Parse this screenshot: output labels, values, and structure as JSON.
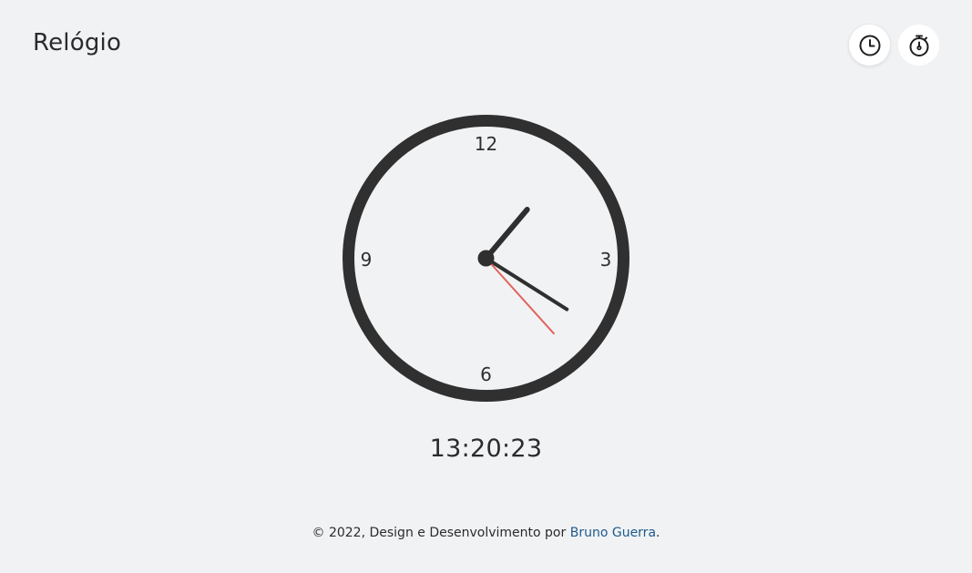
{
  "header": {
    "title": "Relógio"
  },
  "mode_switcher": {
    "items": [
      {
        "icon": "clock-icon",
        "active": true
      },
      {
        "icon": "stopwatch-icon",
        "active": false
      }
    ]
  },
  "clock": {
    "numerals": {
      "twelve": "12",
      "three": "3",
      "six": "6",
      "nine": "9"
    },
    "time": {
      "hours": 13,
      "minutes": 20,
      "seconds": 23
    },
    "colors": {
      "frame": "#303030",
      "face": "#f1f2f4",
      "hands": "#2f2f2f",
      "second_hand": "#e0645c"
    }
  },
  "digital": {
    "time_text": "13:20:23"
  },
  "footer": {
    "prefix": "© 2022, Design e Desenvolvimento por ",
    "author_link": "Bruno Guerra",
    "suffix": "."
  }
}
